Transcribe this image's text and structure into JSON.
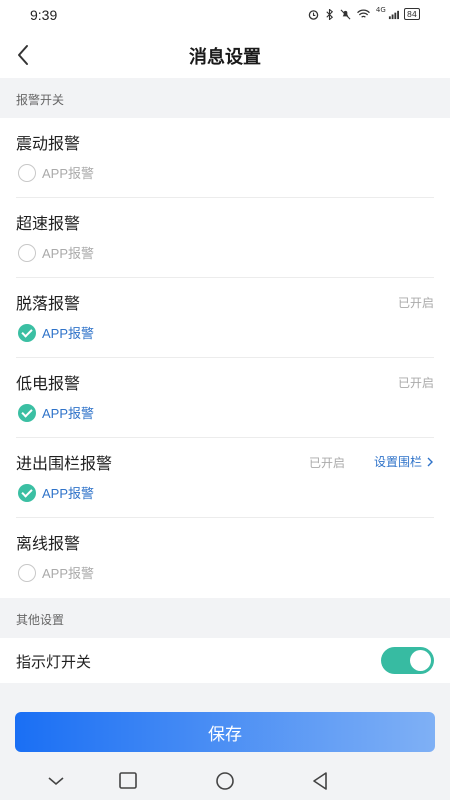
{
  "status": {
    "time": "9:39",
    "network": "4G",
    "battery": "84"
  },
  "nav": {
    "title": "消息设置"
  },
  "sections": {
    "alarm": "报警开关",
    "other": "其他设置"
  },
  "items": [
    {
      "title": "震动报警",
      "status": "",
      "check": "APP报警",
      "checked": false
    },
    {
      "title": "超速报警",
      "status": "",
      "check": "APP报警",
      "checked": false
    },
    {
      "title": "脱落报警",
      "status": "已开启",
      "check": "APP报警",
      "checked": true
    },
    {
      "title": "低电报警",
      "status": "已开启",
      "check": "APP报警",
      "checked": true
    },
    {
      "title": "进出围栏报警",
      "status": "已开启",
      "link": "设置围栏",
      "check": "APP报警",
      "checked": true
    },
    {
      "title": "离线报警",
      "status": "",
      "check": "APP报警",
      "checked": false
    }
  ],
  "toggle": {
    "label": "指示灯开关",
    "on": true
  },
  "save_label": "保存",
  "colors": {
    "accent": "#2f73c9",
    "check": "#3bbfa3",
    "toggle": "#37bba2",
    "button_start": "#1a6ff4",
    "button_end": "#7fb0f5"
  }
}
